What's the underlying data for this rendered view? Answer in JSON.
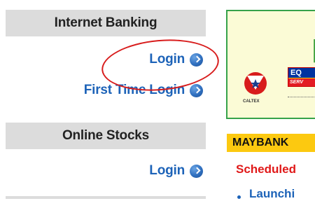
{
  "sidebar": {
    "sections": [
      {
        "title": "Internet Banking",
        "links": [
          {
            "label": "Login"
          },
          {
            "label": "First Time Login"
          }
        ]
      },
      {
        "title": "Online Stocks",
        "links": [
          {
            "label": "Login"
          }
        ]
      }
    ]
  },
  "banner": {
    "big_letter": "F",
    "caltex_label": "CALTEX",
    "eq_logo_top": "EQ",
    "eq_logo_bottom": "SERV"
  },
  "news": {
    "header": "MAYBANK",
    "scheduled": "Scheduled",
    "launch": "Launchi"
  },
  "colors": {
    "link_blue": "#1d63b8",
    "header_gray": "#dcdcdc",
    "news_yellow": "#fcc910",
    "highlight_red": "#d81c1c",
    "banner_border_green": "#36a24a"
  }
}
